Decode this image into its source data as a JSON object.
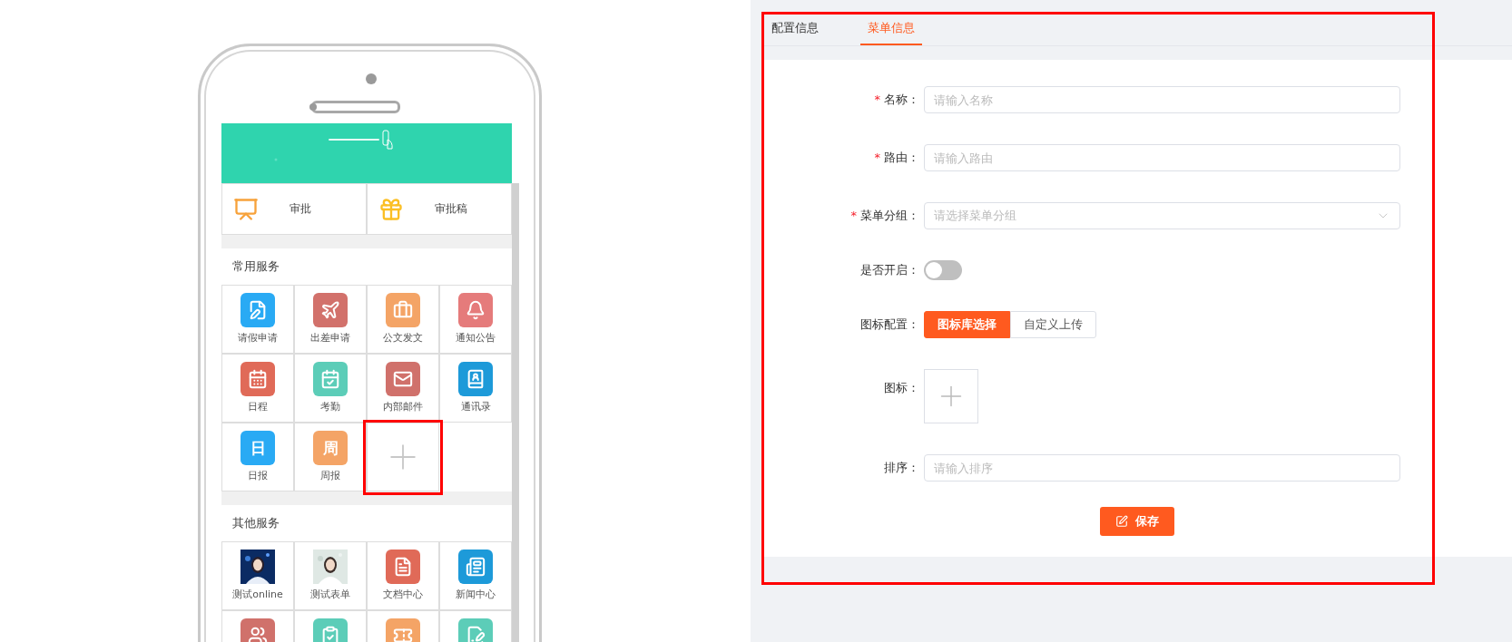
{
  "phone": {
    "top_items": [
      {
        "label": "审批",
        "color": "#f7a23b"
      },
      {
        "label": "审批稿",
        "color": "#fbbf24"
      }
    ],
    "sections": [
      {
        "title": "常用服务",
        "items": [
          {
            "kind": "icon",
            "label": "请假申请",
            "color": "#29aaf4"
          },
          {
            "kind": "icon",
            "label": "出差申请",
            "color": "#d2716b"
          },
          {
            "kind": "icon",
            "label": "公文发文",
            "color": "#f4a466"
          },
          {
            "kind": "icon",
            "label": "通知公告",
            "color": "#e57b7b"
          },
          {
            "kind": "icon",
            "label": "日程",
            "color": "#e06a58"
          },
          {
            "kind": "icon",
            "label": "考勤",
            "color": "#5ccdb8"
          },
          {
            "kind": "icon",
            "label": "内部邮件",
            "color": "#d0716b"
          },
          {
            "kind": "icon",
            "label": "通讯录",
            "color": "#1d9ad9"
          },
          {
            "kind": "glyph",
            "glyph": "日",
            "label": "日报",
            "color": "#29aaf4"
          },
          {
            "kind": "glyph",
            "glyph": "周",
            "label": "周报",
            "color": "#f4a466"
          },
          {
            "kind": "add",
            "highlighted": true
          }
        ]
      },
      {
        "title": "其他服务",
        "items": [
          {
            "kind": "picture",
            "label": "测试online"
          },
          {
            "kind": "picture",
            "label": "测试表单"
          },
          {
            "kind": "icon",
            "label": "文档中心",
            "color": "#e06a58"
          },
          {
            "kind": "icon",
            "label": "新闻中心",
            "color": "#1d9ad9"
          },
          {
            "kind": "icon",
            "color": "#d0716b"
          },
          {
            "kind": "icon",
            "color": "#5ccdb8"
          },
          {
            "kind": "icon",
            "color": "#f4a466"
          },
          {
            "kind": "icon",
            "color": "#5ccdb8"
          }
        ]
      }
    ]
  },
  "tabs": [
    {
      "label": "配置信息",
      "selected": false
    },
    {
      "label": "菜单信息",
      "selected": true
    }
  ],
  "form": {
    "fields": [
      {
        "kind": "text",
        "label": "名称：",
        "required": true,
        "placeholder": "请输入名称"
      },
      {
        "kind": "text",
        "label": "路由：",
        "required": true,
        "placeholder": "请输入路由"
      },
      {
        "kind": "select",
        "label": "菜单分组：",
        "required": true,
        "placeholder": "请选择菜单分组"
      },
      {
        "kind": "switch",
        "label": "是否开启：",
        "required": false,
        "on": false
      },
      {
        "kind": "segmented",
        "label": "图标配置：",
        "required": false,
        "options": [
          {
            "label": "图标库选择",
            "selected": true
          },
          {
            "label": "自定义上传",
            "selected": false
          }
        ]
      },
      {
        "kind": "upload",
        "label": "图标：",
        "required": false
      },
      {
        "kind": "text",
        "label": "排序：",
        "required": false,
        "placeholder": "请输入排序"
      }
    ],
    "required_mark": "*",
    "save_button": "保存"
  },
  "highlight": true
}
